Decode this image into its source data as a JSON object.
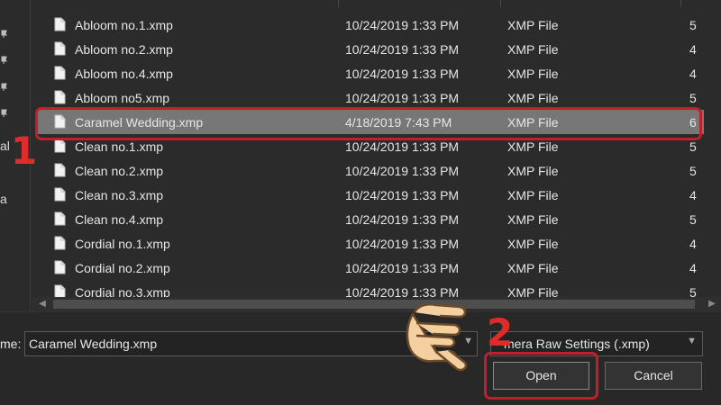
{
  "nav": {
    "fragments": [
      "al",
      "a"
    ]
  },
  "files": [
    {
      "name": "Abloom no.1.xmp",
      "date": "10/24/2019 1:33 PM",
      "type": "XMP File",
      "size": "5"
    },
    {
      "name": "Abloom no.2.xmp",
      "date": "10/24/2019 1:33 PM",
      "type": "XMP File",
      "size": "4"
    },
    {
      "name": "Abloom no.4.xmp",
      "date": "10/24/2019 1:33 PM",
      "type": "XMP File",
      "size": "4"
    },
    {
      "name": "Abloom no5.xmp",
      "date": "10/24/2019 1:33 PM",
      "type": "XMP File",
      "size": "5"
    },
    {
      "name": "Caramel Wedding.xmp",
      "date": "4/18/2019 7:43 PM",
      "type": "XMP File",
      "size": "6",
      "selected": true
    },
    {
      "name": "Clean no.1.xmp",
      "date": "10/24/2019 1:33 PM",
      "type": "XMP File",
      "size": "5"
    },
    {
      "name": "Clean no.2.xmp",
      "date": "10/24/2019 1:33 PM",
      "type": "XMP File",
      "size": "5"
    },
    {
      "name": "Clean no.3.xmp",
      "date": "10/24/2019 1:33 PM",
      "type": "XMP File",
      "size": "4"
    },
    {
      "name": "Clean no.4.xmp",
      "date": "10/24/2019 1:33 PM",
      "type": "XMP File",
      "size": "5"
    },
    {
      "name": "Cordial no.1.xmp",
      "date": "10/24/2019 1:33 PM",
      "type": "XMP File",
      "size": "4"
    },
    {
      "name": "Cordial no.2.xmp",
      "date": "10/24/2019 1:33 PM",
      "type": "XMP File",
      "size": "4"
    },
    {
      "name": "Cordial no.3.xmp",
      "date": "10/24/2019 1:33 PM",
      "type": "XMP File",
      "size": "5"
    }
  ],
  "footer": {
    "filename_label": "me:",
    "filename_value": "Caramel Wedding.xmp",
    "filetype_value": "mera Raw Settings (.xmp)",
    "open_label": "Open",
    "cancel_label": "Cancel"
  },
  "annotations": {
    "step1": "1",
    "step2": "2",
    "color": "#e32a2a"
  },
  "icons": {
    "file": "file-icon",
    "pin": "pin-icon",
    "dropdown": "chevron-down-icon",
    "hand": "pointing-hand-icon"
  }
}
